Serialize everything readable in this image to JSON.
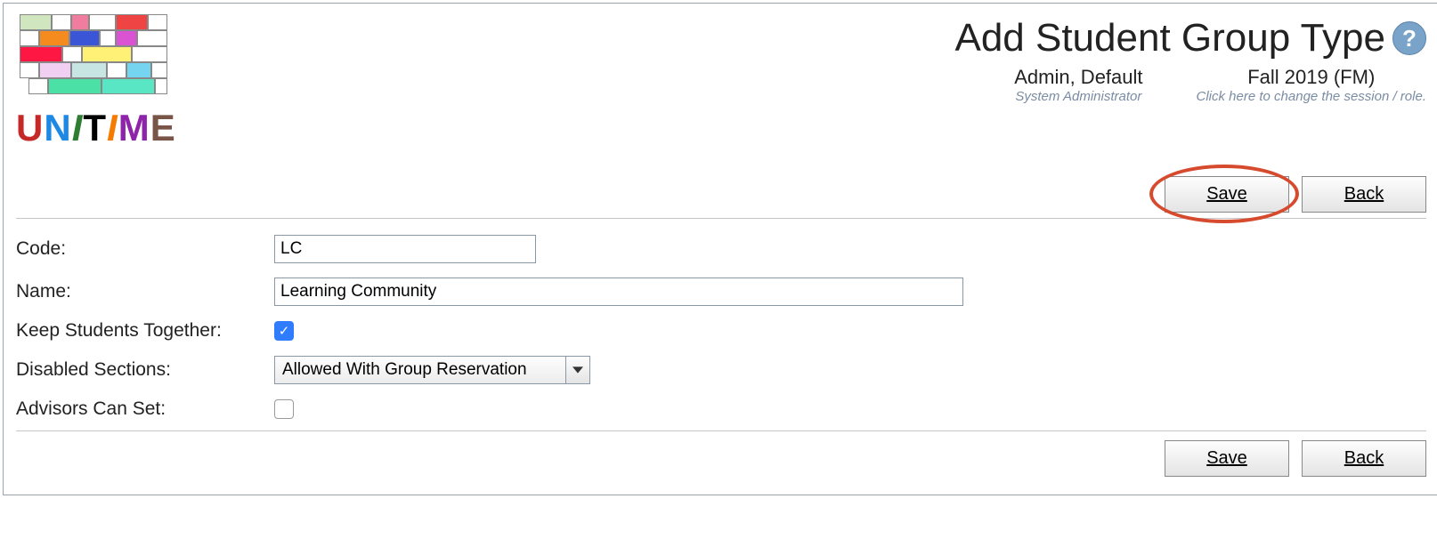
{
  "logo": {
    "text": "UniTime"
  },
  "page_title": "Add Student Group Type",
  "user": {
    "name": "Admin, Default",
    "role": "System Administrator"
  },
  "session": {
    "name": "Fall 2019 (FM)",
    "hint": "Click here to change the session / role."
  },
  "buttons": {
    "save": "Save",
    "back": "Back"
  },
  "form": {
    "code": {
      "label": "Code:",
      "value": "LC"
    },
    "name": {
      "label": "Name:",
      "value": "Learning Community"
    },
    "keep_together": {
      "label": "Keep Students Together:",
      "checked": true
    },
    "disabled_sections": {
      "label": "Disabled Sections:",
      "value": "Allowed With Group Reservation"
    },
    "advisors_can_set": {
      "label": "Advisors Can Set:",
      "checked": false
    }
  }
}
